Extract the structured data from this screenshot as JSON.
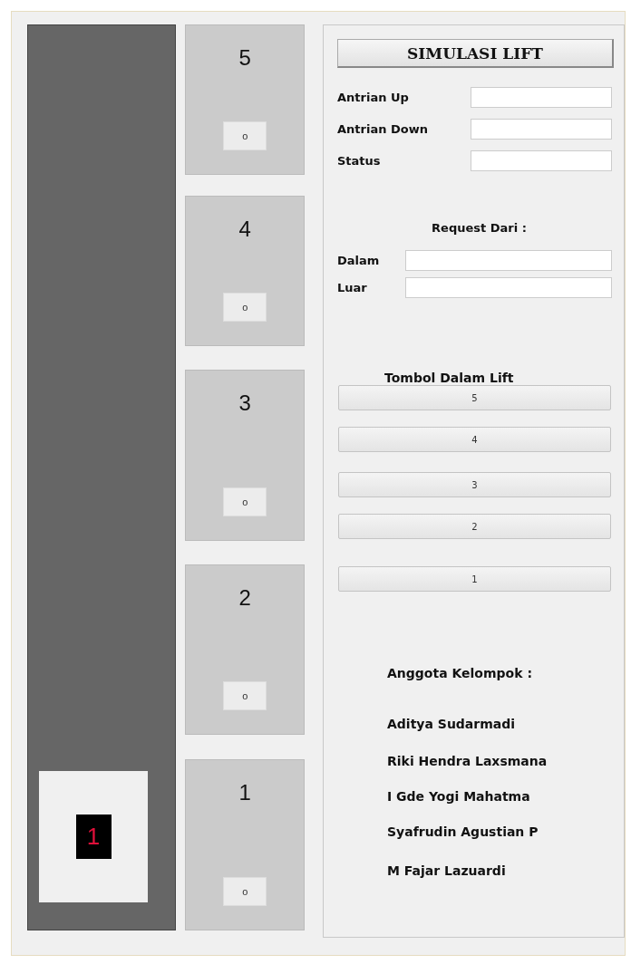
{
  "shaft": {
    "car": {
      "display": "1"
    }
  },
  "floors": [
    {
      "label": "5",
      "button": "o"
    },
    {
      "label": "4",
      "button": "o"
    },
    {
      "label": "3",
      "button": "o"
    },
    {
      "label": "2",
      "button": "o"
    },
    {
      "label": "1",
      "button": "o"
    }
  ],
  "panel": {
    "title": "SIMULASI LIFT",
    "status_fields": [
      {
        "label": "Antrian Up"
      },
      {
        "label": "Antrian Down"
      },
      {
        "label": "Status"
      }
    ],
    "request_heading": "Request Dari :",
    "request_fields": [
      {
        "label": "Dalam"
      },
      {
        "label": "Luar"
      }
    ],
    "inside_heading": "Tombol Dalam Lift",
    "inside_buttons": [
      "5",
      "4",
      "3",
      "2",
      "1"
    ],
    "members_heading": "Anggota Kelompok :",
    "members": [
      "Aditya Sudarmadi",
      "Riki Hendra Laxsmana",
      "I Gde Yogi Mahatma",
      "Syafrudin Agustian P",
      "M Fajar Lazuardi"
    ]
  }
}
